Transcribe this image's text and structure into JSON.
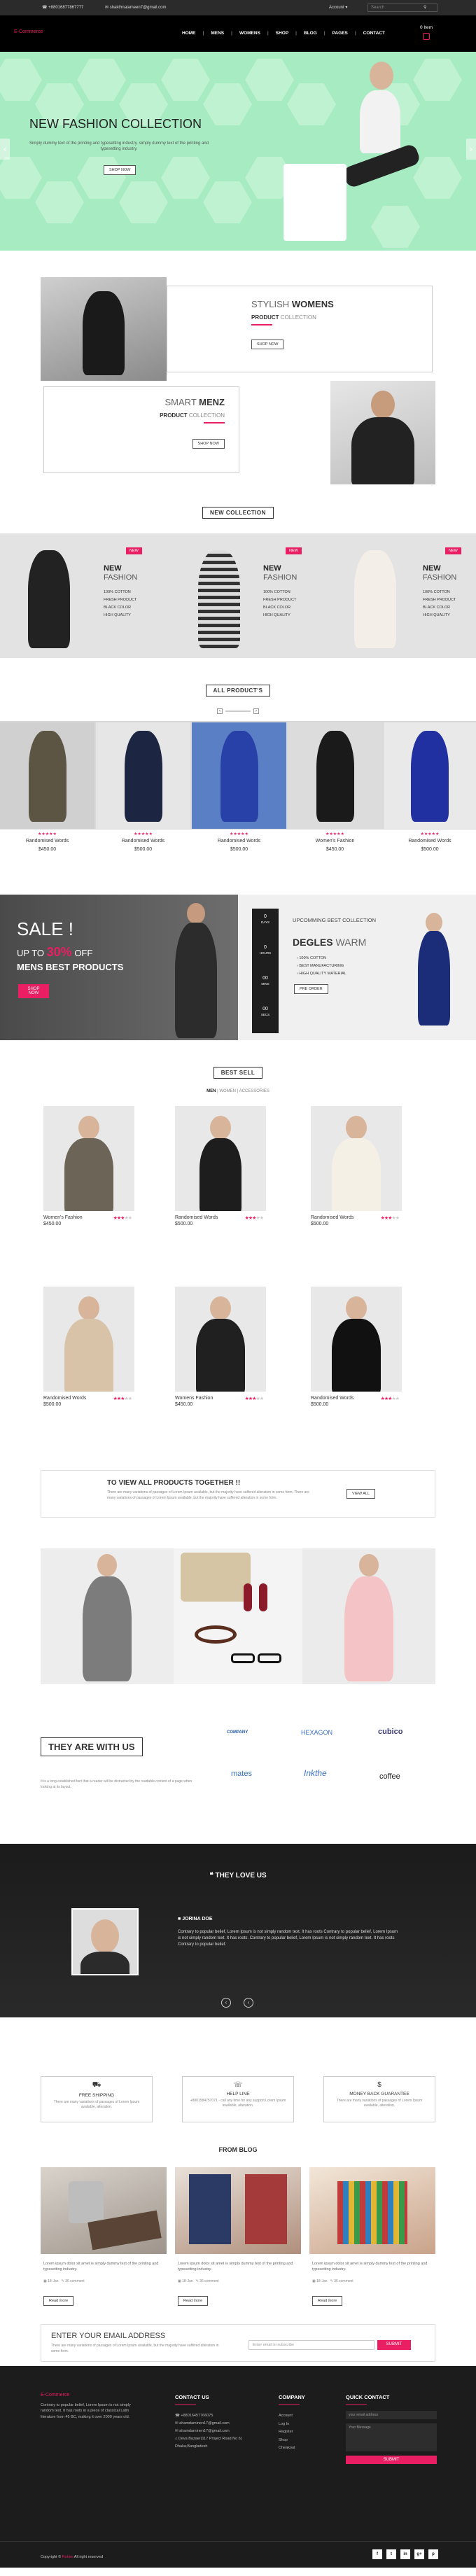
{
  "topbar": {
    "phone": "+88016877867777",
    "email": "shakthnalameen7@gmail.com",
    "account": "Account",
    "search_placeholder": "Search"
  },
  "nav": {
    "logo": "E-Commerce",
    "menu": [
      "HOME",
      "MENS",
      "WOMENS",
      "SHOP",
      "BLOG",
      "PAGES",
      "CONTACT"
    ],
    "cart_label": "0 Item"
  },
  "hero": {
    "title": "NEW FASHION COLLECTION",
    "text": "Simply dummy text of the printing and typesetting industry. simply dummy text of the printing and typesetting industry.",
    "button": "SHOP NOW"
  },
  "promos": {
    "women": {
      "title1": "STYLISH",
      "title2": "WOMENS",
      "sub1": "PRODUCT",
      "sub2": "COLLECTION",
      "button": "SHOP NOW"
    },
    "men": {
      "title1": "SMART",
      "title2": "MENZ",
      "sub1": "PRODUCT",
      "sub2": "COLLECTION",
      "button": "SHOP NOW"
    }
  },
  "new_collection": {
    "title": "NEW COLLECTION",
    "cards": [
      {
        "badge": "NEW",
        "h1": "NEW",
        "h2": "FASHION",
        "features": [
          "100% COTTON",
          "FRESH PRODUCT",
          "BLACK COLOR",
          "HIGH QUALITY"
        ]
      },
      {
        "badge": "NEW",
        "h1": "NEW",
        "h2": "FASHION",
        "features": [
          "100% COTTON",
          "FRESH PRODUCT",
          "BLACK COLOR",
          "HIGH QUALITY"
        ]
      },
      {
        "badge": "NEW",
        "h1": "NEW",
        "h2": "FASHION",
        "features": [
          "100% COTTON",
          "FRESH PRODUCT",
          "BLACK COLOR",
          "HIGH QUALITY"
        ]
      }
    ]
  },
  "all_products": {
    "title": "ALL PRODUCT'S",
    "items": [
      {
        "name": "Randomised Words",
        "price": "$450.00"
      },
      {
        "name": "Randomised Words",
        "price": "$500.00"
      },
      {
        "name": "Randomised Words",
        "price": "$500.00"
      },
      {
        "name": "Women's Fashion",
        "price": "$450.00"
      },
      {
        "name": "Randomised Words",
        "price": "$500.00"
      }
    ]
  },
  "sale": {
    "title": "SALE !",
    "upto": "UP TO",
    "pct": "30%",
    "off": "OFF",
    "subtitle": "MENS BEST PRODUCTS",
    "button": "SHOP NOW",
    "countdown": [
      {
        "n": "0",
        "l": "DAYS"
      },
      {
        "n": "0",
        "l": "HOURS"
      },
      {
        "n": "00",
        "l": "MINS"
      },
      {
        "n": "00",
        "l": "SECS"
      }
    ],
    "upcoming": "UPCOMMING BEST COLLECTION",
    "brand1": "DEGLES",
    "brand2": "WARM",
    "features": [
      "100% COTTON",
      "BEST MANUFACTURING",
      "HIGH QUALITY MATERIAL"
    ],
    "order": "PRE ORDER"
  },
  "best_sell": {
    "title": "BEST SELL",
    "tabs": [
      "MEN",
      "WOMEN",
      "ACCESSORIES"
    ],
    "items": [
      {
        "name": "Women's Fashion",
        "price": "$450.00"
      },
      {
        "name": "Randomised Words",
        "price": "$500.00"
      },
      {
        "name": "Randomised Words",
        "price": "$500.00"
      },
      {
        "name": "Randomised Words",
        "price": "$500.00"
      },
      {
        "name": "Womens Fashion",
        "price": "$450.00"
      },
      {
        "name": "Randomised Words",
        "price": "$500.00"
      }
    ]
  },
  "view_all": {
    "title": "TO VIEW ALL PRODUCTS TOGETHER !!",
    "text": "There are many variations of passages of Lorem Ipsum available, but the majority have suffered alteration in some form. There are many variations of passages of Lorem Ipsum available, but the majority have suffered alteration in some form.",
    "button": "VIEW ALL"
  },
  "partners": {
    "title": "THEY ARE WITH US",
    "text": "It is a long established fact that a reader will be distracted by the readable content of a page when looking at its layout.",
    "logos": [
      "COMPANY",
      "HEXAGON",
      "cubico",
      "mates",
      "Inkthe",
      "coffee"
    ]
  },
  "testimonial": {
    "title": "THEY LOVE US",
    "name": "JORINA DOE",
    "text": "Contrary to popular belief, Lorem Ipsum is not simply random text. It has roots Contrary to popular belief, Lorem Ipsum is not simply random text. It has roots. Contrary to popular belief, Lorem Ipsum is not simply random text. It has roots Contrary to popular belief."
  },
  "services": [
    {
      "title": "FREE SHIPPING",
      "text": "There are many variations of passages of Lorem Ipsum available, alteration."
    },
    {
      "title": "HELP LINE",
      "text": "+8801584757071 - call any time for any support Lorem Ipsum available, alteration."
    },
    {
      "title": "MONEY BACK GUARANTEE",
      "text": "There are many variations of passages of Lorem Ipsum available, alteration."
    }
  ],
  "blog": {
    "title": "FROM BLOG",
    "posts": [
      {
        "text": "Lorem ipsum dolor sit amet is simply dummy text of the printing and typesetting industry.",
        "date": "18-Jan",
        "comments": "36 comment",
        "button": "Read more"
      },
      {
        "text": "Lorem ipsum dolor sit amet is simply dummy text of the printing and typesetting industry.",
        "date": "18-Jan",
        "comments": "36 comment",
        "button": "Read more"
      },
      {
        "text": "Lorem ipsum dolor sit amet is simply dummy text of the printing and typesetting industry.",
        "date": "18-Jan",
        "comments": "36 comment",
        "button": "Read more"
      }
    ]
  },
  "newsletter": {
    "title": "ENTER YOUR EMAIL ADDRESS",
    "text": "There are many variations of passages of Lorem Ipsum available, but the majority have suffered alteration in some form.",
    "placeholder": "Enter email to subscribe",
    "button": "SUBMIT"
  },
  "footer": {
    "logo": "E-Commerce",
    "about": "Contrary to popular belief, Lorem Ipsum is not simply random text. It has roots in a piece of classical Latin literature from 45 BC, making it over 2000 years old.",
    "contact_title": "CONTACT US",
    "contacts": [
      "+88016457766075",
      "ahamdaminen17@gmail.com",
      "ahamdaminen17@gmail.com",
      "Deva Bazaer(117 Project Road No 6) Dhaka,Bangladesh"
    ],
    "company_title": "COMPANY",
    "company_links": [
      "Account",
      "Log In",
      "Register",
      "Shop",
      "Cheakout"
    ],
    "quick_title": "QUICK CONTACT",
    "email_placeholder": "your email address",
    "message_placeholder": "Your Message",
    "submit": "SUBMIT",
    "copyright_prefix": "Copyright ©",
    "copyright_brand": "Rohim",
    "copyright_suffix": "All right reserved",
    "social": [
      "f",
      "t",
      "in",
      "g+",
      "p"
    ]
  }
}
